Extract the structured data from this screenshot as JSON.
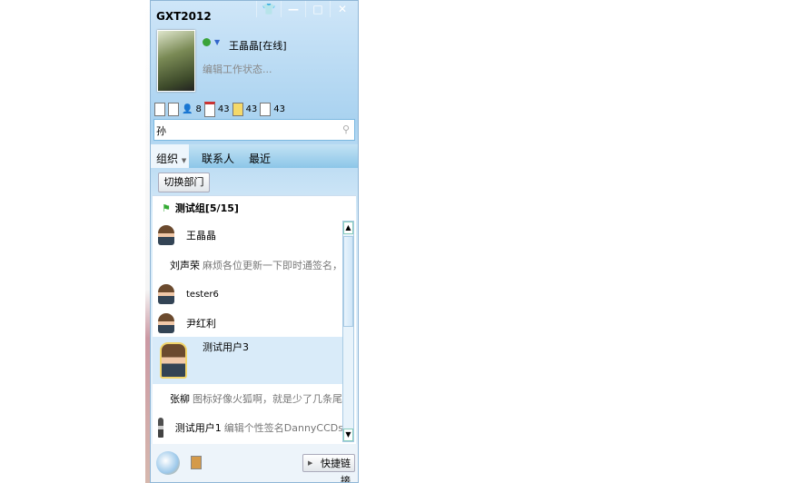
{
  "window": {
    "title": "GXT2012",
    "controls": [
      "skin",
      "minimize",
      "maximize",
      "close"
    ]
  },
  "profile": {
    "name": "王晶晶[在线]",
    "signature": "编辑工作状态..."
  },
  "toolbar": {
    "counts": [
      "8",
      "43",
      "43",
      "43"
    ]
  },
  "search": {
    "value": "孙"
  },
  "tabs": [
    "组织",
    "联系人",
    "最近"
  ],
  "switch_label": "切换部门",
  "group": {
    "label": "测试组[5/15]"
  },
  "contacts": [
    {
      "name": "王晶晶",
      "sig": ""
    },
    {
      "name": "刘声荣",
      "sig": "麻烦各位更新一下即时通签名，旧"
    },
    {
      "name": "tester6",
      "sig": ""
    },
    {
      "name": "尹红利",
      "sig": ""
    },
    {
      "name": "测试用户3",
      "sig": ""
    },
    {
      "name": "张柳",
      "sig": "图标好像火狐啊，就是少了几条尾巴"
    },
    {
      "name": "测试用户1",
      "sig": "编辑个性签名DannyCCDs"
    }
  ],
  "quick_link": "快捷链接"
}
